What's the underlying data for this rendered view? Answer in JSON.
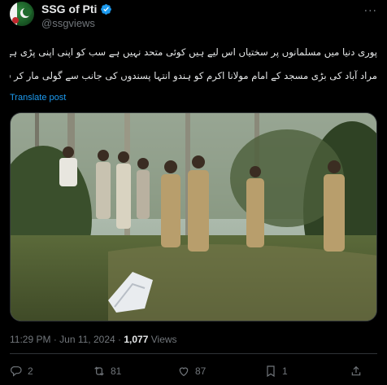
{
  "account": {
    "display_name": "SSG of Pti",
    "handle": "@ssgviews",
    "verified": true,
    "verified_color": "#1d9bf0"
  },
  "tweet": {
    "lines": [
      "پوری دنیا میں مسلمانوں پر سختیاں اس لیے ہیں کوئی متحد نہیں ہے سب کو اپنی اپنی پڑی ہے اس لیے کفار منہ زور ہو رہا ہے بھارت یوپی کے",
      "مراد آباد کی بڑی مسجد کے امام مولانا اکرم کو ہندو انتہا پسندوں کی جانب سے گولی مار کر قتل کر دیا گیا۔ پاکستان کا میڈیا کدھر ہے ؟"
    ],
    "translate_label": "Translate post",
    "link_color": "#1d9bf0"
  },
  "media": {
    "icon": "video-thumbnail"
  },
  "meta": {
    "time": "11:29 PM",
    "separator": "·",
    "date": "Jun 11, 2024",
    "views_count": "1,077",
    "views_label": "Views"
  },
  "actions": {
    "replies": "2",
    "reposts": "81",
    "likes": "87",
    "bookmarks": "1",
    "reply_icon": "reply-icon",
    "repost_icon": "repost-icon",
    "like_icon": "heart-icon",
    "bookmark_icon": "bookmark-icon",
    "share_icon": "share-icon"
  }
}
